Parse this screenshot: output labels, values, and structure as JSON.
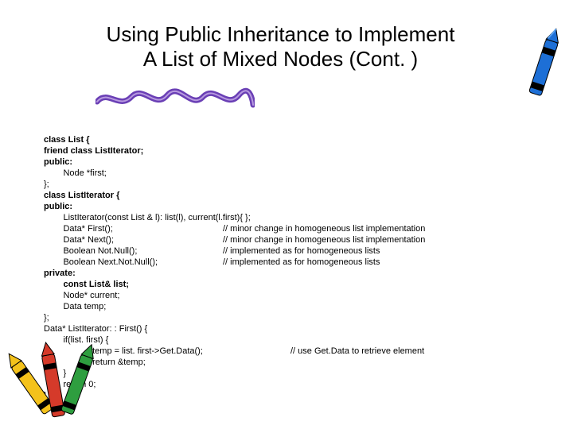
{
  "title_line1": "Using Public Inheritance to Implement",
  "title_line2": "A List of Mixed Nodes (Cont. )",
  "code": {
    "l01": "class List {",
    "l02": "friend class ListIterator;",
    "l03": "public:",
    "l04": "        Node *first;",
    "l05": "};",
    "l06": "class ListIterator {",
    "l07": "public:",
    "l08a": "        ListIterator(const List & l): list(l), current(l.first){ };",
    "l09a": "        Data* First();",
    "l09b": "// minor change in homogeneous list implementation",
    "l10a": "        Data* Next();",
    "l10b": "// minor change in homogeneous list implementation",
    "l11a": "        Boolean Not.Null();",
    "l11b": "// implemented as for homogeneous lists",
    "l12a": "        Boolean Next.Not.Null();",
    "l12b": "// implemented as for homogeneous lists",
    "l13": "private:",
    "l14": "        const List& list;",
    "l15": "        Node* current;",
    "l16": "        Data temp;",
    "l17": "};",
    "l18": "Data* ListIterator: : First() {",
    "l19": "        if(list. first) {",
    "l20a": "                    temp = list. first->Get.Data();",
    "l20b": "// use Get.Data to retrieve element",
    "l21": "                    return &temp;",
    "l22": "        }",
    "l23": "        return 0;",
    "l24": "}"
  }
}
